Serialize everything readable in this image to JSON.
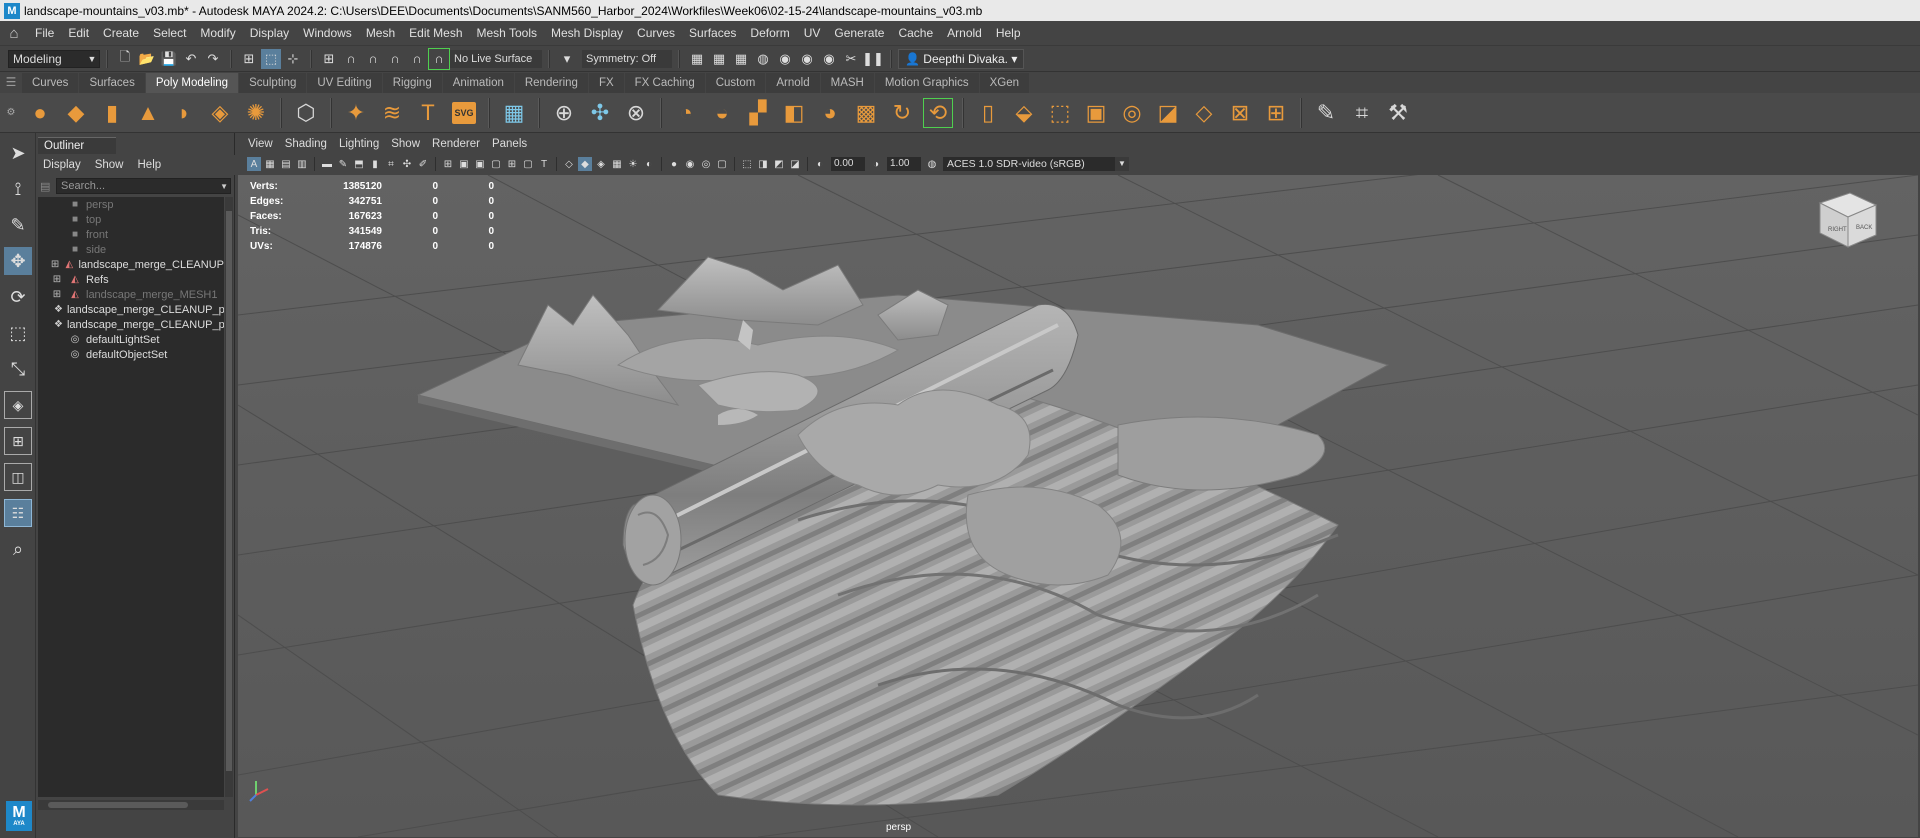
{
  "window": {
    "title": "landscape-mountains_v03.mb* - Autodesk MAYA 2024.2: C:\\Users\\DEE\\Documents\\Documents\\SANM560_Harbor_2024\\Workfiles\\Week06\\02-15-24\\landscape-mountains_v03.mb",
    "logo_letter": "M"
  },
  "menubar": {
    "items": [
      "File",
      "Edit",
      "Create",
      "Select",
      "Modify",
      "Display",
      "Windows",
      "Mesh",
      "Edit Mesh",
      "Mesh Tools",
      "Mesh Display",
      "Curves",
      "Surfaces",
      "Deform",
      "UV",
      "Generate",
      "Cache",
      "Arnold",
      "Help"
    ]
  },
  "statusline": {
    "mode": "Modeling",
    "live_surface": "No Live Surface",
    "symmetry": "Symmetry: Off",
    "user": "Deepthi Divaka."
  },
  "shelf": {
    "tabs": [
      "Curves",
      "Surfaces",
      "Poly Modeling",
      "Sculpting",
      "UV Editing",
      "Rigging",
      "Animation",
      "Rendering",
      "FX",
      "FX Caching",
      "Custom",
      "Arnold",
      "MASH",
      "Motion Graphics",
      "XGen"
    ],
    "active_tab": "Poly Modeling",
    "svg_label": "SVG"
  },
  "outliner": {
    "tab": "Outliner",
    "menu": [
      "Display",
      "Show",
      "Help"
    ],
    "search_placeholder": "Search...",
    "items": [
      {
        "label": "persp",
        "type": "camera",
        "dim": true
      },
      {
        "label": "top",
        "type": "camera",
        "dim": true
      },
      {
        "label": "front",
        "type": "camera",
        "dim": true
      },
      {
        "label": "side",
        "type": "camera",
        "dim": true
      },
      {
        "label": "landscape_merge_CLEANUP",
        "type": "group",
        "dim": false
      },
      {
        "label": "Refs",
        "type": "group",
        "dim": false
      },
      {
        "label": "landscape_merge_MESH1",
        "type": "group",
        "dim": true
      },
      {
        "label": "landscape_merge_CLEANUP_polySurf",
        "type": "mesh",
        "dim": false
      },
      {
        "label": "landscape_merge_CLEANUP_polySurf",
        "type": "mesh",
        "dim": false
      },
      {
        "label": "defaultLightSet",
        "type": "set",
        "dim": false
      },
      {
        "label": "defaultObjectSet",
        "type": "set",
        "dim": false
      }
    ]
  },
  "viewport": {
    "menu": [
      "View",
      "Shading",
      "Lighting",
      "Show",
      "Renderer",
      "Panels"
    ],
    "exposure": "0.00",
    "gamma": "1.00",
    "color_space": "ACES 1.0 SDR-video (sRGB)",
    "camera": "persp",
    "viewcube": {
      "right": "RIGHT",
      "back": "BACK"
    },
    "hud": [
      {
        "label": "Verts:",
        "value": "1385120",
        "sel": "0",
        "comp": "0"
      },
      {
        "label": "Edges:",
        "value": "342751",
        "sel": "0",
        "comp": "0"
      },
      {
        "label": "Faces:",
        "value": "167623",
        "sel": "0",
        "comp": "0"
      },
      {
        "label": "Tris:",
        "value": "341549",
        "sel": "0",
        "comp": "0"
      },
      {
        "label": "UVs:",
        "value": "174876",
        "sel": "0",
        "comp": "0"
      }
    ]
  },
  "toolbox": {
    "logo": "M",
    "logo_sub": "AYA"
  }
}
